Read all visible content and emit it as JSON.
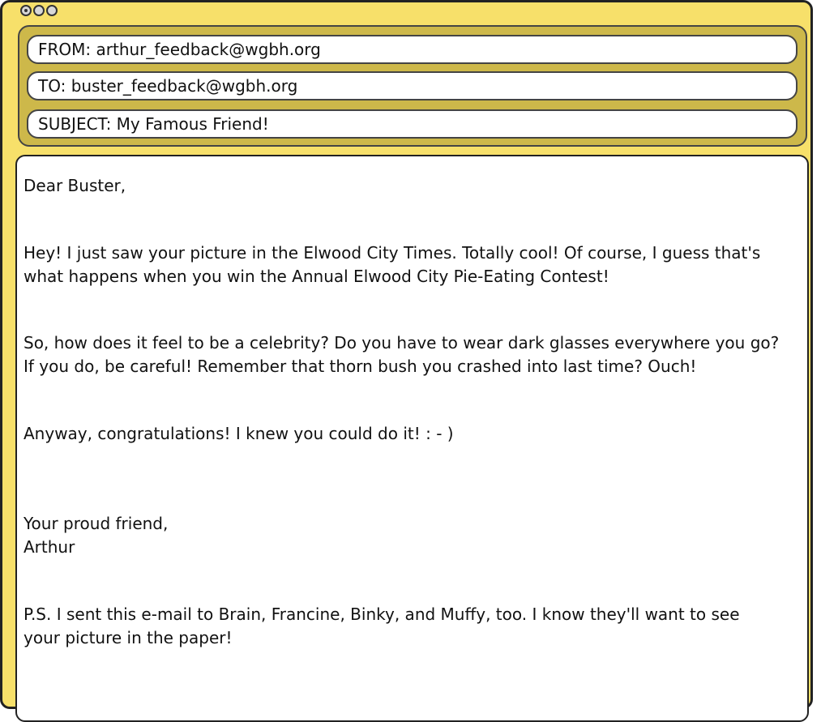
{
  "email": {
    "from": "FROM: arthur_feedback@wgbh.org",
    "to": "TO: buster_feedback@wgbh.org",
    "subject": "SUBJECT: My Famous Friend!"
  },
  "message": {
    "greeting": "Dear Buster,",
    "para1_line1": "Hey! I just saw your picture in the Elwood City Times. Totally cool! Of course, I guess that's",
    "para1_line2": "what happens when you win the Annual Elwood City Pie-Eating Contest!",
    "para2_line1": "So, how does it feel to be a celebrity? Do you have to wear dark glasses everywhere you go?",
    "para2_line2": "If you do, be careful! Remember that thorn bush you crashed into last time? Ouch!",
    "para3": "Anyway, congratulations! I knew you could do it! : - )",
    "closing": "Your proud friend,",
    "signature": "Arthur",
    "ps_line1": "P.S. I sent this e-mail to Brain, Francine, Binky, and Muffy, too. I know they'll want to see",
    "ps_line2": "your picture in the paper!"
  }
}
